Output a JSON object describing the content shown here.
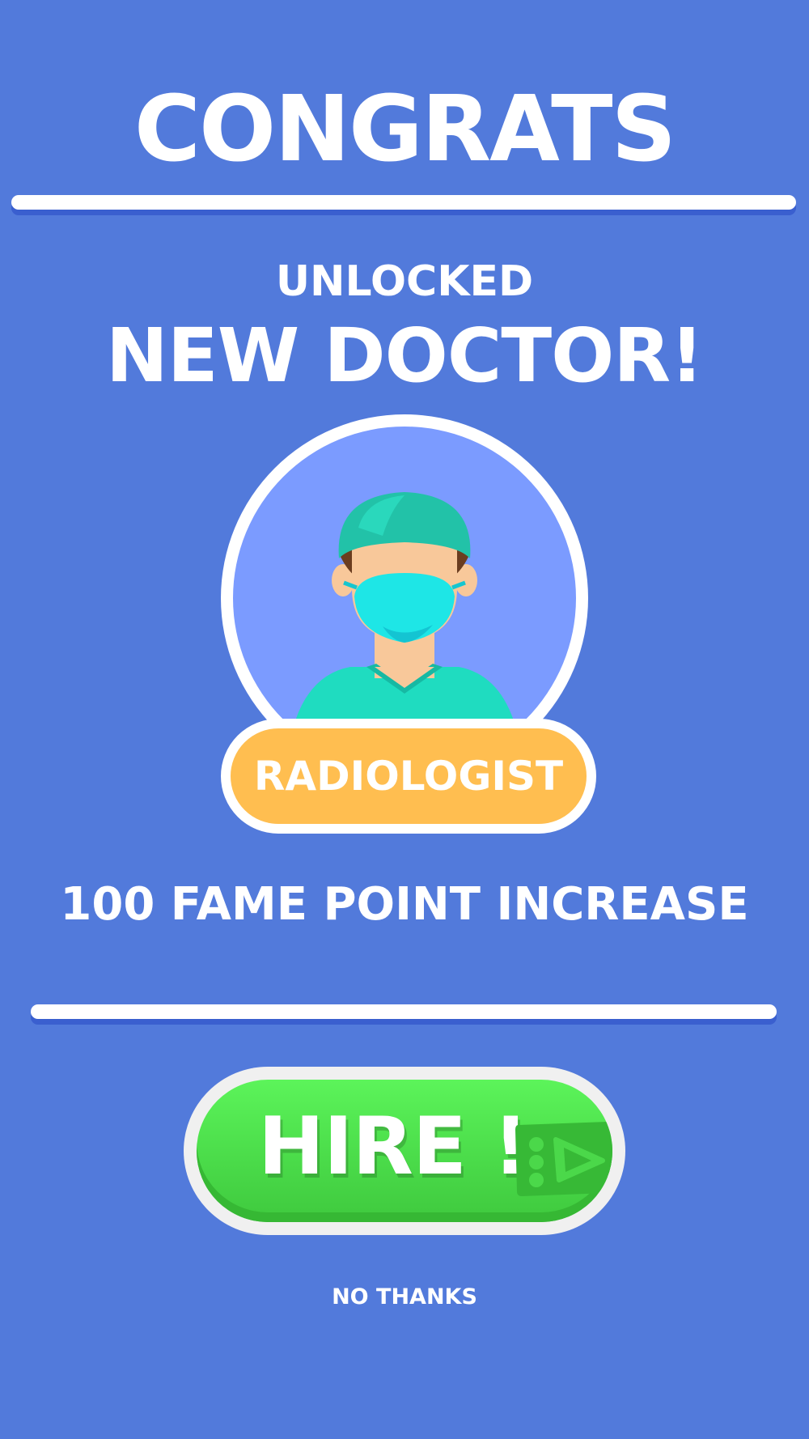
{
  "header": {
    "title": "CONGRATS"
  },
  "unlock": {
    "subtitle": "UNLOCKED",
    "headline": "NEW DOCTOR!"
  },
  "doctor": {
    "role": "RADIOLOGIST",
    "icon": "doctor-avatar-icon"
  },
  "reward": {
    "text": "100 FAME POINT INCREASE"
  },
  "actions": {
    "hire_label": "HIRE !",
    "hire_icon": "video-play-icon",
    "decline_label": "NO THANKS"
  },
  "colors": {
    "background": "#527adb",
    "portrait_fill": "#7b9bff",
    "badge": "#ffbe50",
    "hire_button": "#4bdc4a",
    "scrubs": "#1fdcc0",
    "mask": "#1ee6e6"
  }
}
